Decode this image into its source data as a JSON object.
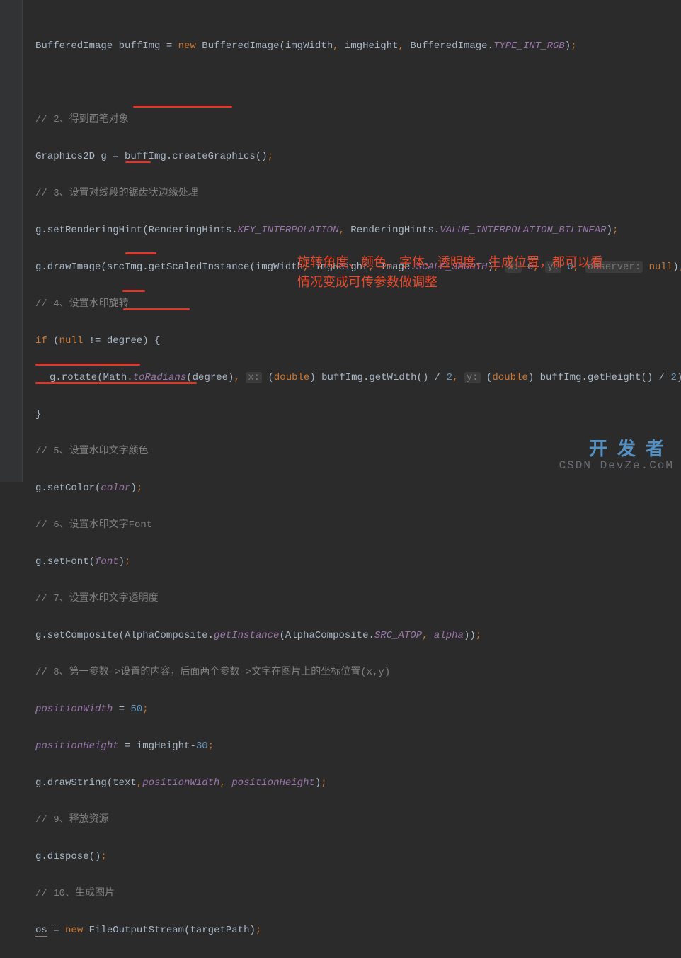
{
  "lines": {
    "l1": "BufferedImage buffImg = ",
    "l1_kw": "new",
    "l1_post": " BufferedImage(imgWidth",
    "l1_c1": ",",
    "l1_a2": " imgHeight",
    "l1_c2": ",",
    "l1_a3": " BufferedImage.",
    "l1_const": "TYPE_INT_RGB",
    "l1_end": ")",
    "l1_sc": ";",
    "c2": "// 2、得到画笔对象",
    "l3": "Graphics2D g = buffImg.createGraphics()",
    "l3_sc": ";",
    "c4": "// 3、设置对线段的锯齿状边缘处理",
    "l5a": "g.setRenderingHint(RenderingHints.",
    "l5b": "KEY_INTERPOLATION",
    "l5c": ",",
    "l5d": " RenderingHints.",
    "l5e": "VALUE_INTERPOLATION_BILINEAR",
    "l5f": ")",
    "l5g": ";",
    "l6a": "g.drawImage(srcImg.getScaledInstance(imgWidth",
    "l6c1": ",",
    "l6b": " imgHeight",
    "l6c2": ",",
    "l6c": " Image.",
    "l6d": "SCALE_SMOOTH",
    "l6e": ")",
    "l6cm": ",",
    "l6h1": "x:",
    "l6n1": " 0",
    "l6cm2": ",",
    "l6h2": "y:",
    "l6n2": " 0",
    "l6cm3": ",",
    "l6h3": "observer:",
    "l6nul": " null",
    "l6end": ")",
    "l6sc": ";",
    "c7": "// 4、设置水印旋转",
    "l8_if": "if",
    "l8_a": " (",
    "l8_null": "null",
    "l8_b": " != degree) {",
    "l9a": "g.rotate(Math.",
    "l9b": "toRadians",
    "l9c": "(degree)",
    "l9cm": ",",
    "l9h1": "x:",
    "l9d": " (",
    "l9dbl1": "double",
    "l9e": ") buffImg.getWidth() / ",
    "l9n1": "2",
    "l9cm2": ",",
    "l9h2": "y:",
    "l9f": " (",
    "l9dbl2": "double",
    "l9g": ") buffImg.getHeight() / ",
    "l9n2": "2",
    "l9end": ")",
    "l9sc": ";",
    "l10": "}",
    "c11": "// 5、设置水印文字颜色",
    "l12a": "g.setColor(",
    "l12b": "color",
    "l12c": ")",
    "l12sc": ";",
    "c13": "// 6、设置水印文字Font",
    "l14a": "g.setFont(",
    "l14b": "font",
    "l14c": ")",
    "l14sc": ";",
    "c15": "// 7、设置水印文字透明度",
    "l16a": "g.setComposite(AlphaComposite.",
    "l16b": "getInstance",
    "l16c": "(AlphaComposite.",
    "l16d": "SRC_ATOP",
    "l16e": ",",
    "l16f": " alpha",
    "l16g": "))",
    "l16sc": ";",
    "c17": "// 8、第一参数->设置的内容，后面两个参数->文字在图片上的坐标位置(x,y)",
    "l18a": "positionWidth",
    "l18b": " = ",
    "l18c": "50",
    "l18sc": ";",
    "l19a": "positionHeight",
    "l19b": " = imgHeight-",
    "l19c": "30",
    "l19sc": ";",
    "l20a": "g.drawString(text",
    "l20cm": ",",
    "l20b": "positionWidth",
    "l20cm2": ",",
    "l20c": " positionHeight",
    "l20d": ")",
    "l20sc": ";",
    "c21": "// 9、释放资源",
    "l22a": "g.dispose()",
    "l22sc": ";",
    "c23": "// 10、生成图片",
    "l24a": "os",
    "l24b": " = ",
    "l24c": "new",
    "l24d": " FileOutputStream(targetPath)",
    "l24sc": ";"
  },
  "annotation": {
    "line1": "旋转角度、颜色、字体、透明度、生成位置，都可以看",
    "line2": "情况变成可传参数做调整"
  },
  "watermark": {
    "top": "开发者",
    "bottom": "CSDN DevZe.CoM"
  }
}
